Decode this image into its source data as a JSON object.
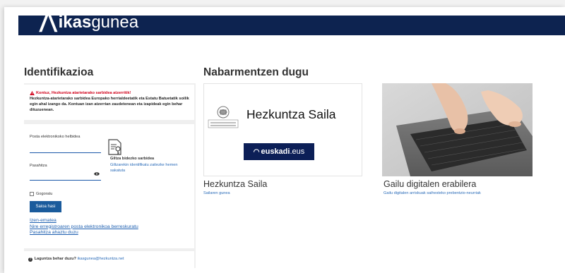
{
  "header": {
    "brand_bold": "ikas",
    "brand_rest": "gunea",
    "menu_icon": "hamburger-icon"
  },
  "login_panel": {
    "heading": "Identifikazioa",
    "warning": {
      "title": "Kontuz, Hezkuntza atarietarako sarbidea atzerritik!",
      "body": "Hezkuntza-atarietarako sarbidea Europako herrialdeetatik eta Estatu Batuetatik soilik egin ahal izango da. Kontuan izan atzerrian zaudetenean eta izapideak egin behar dituzuenean.",
      "icon": "warning-triangle-icon",
      "color": "#d0021b"
    },
    "email_label": "Posta elektronikoko helbidea",
    "email_value": "",
    "password_label": "Pasahitza",
    "password_value": "",
    "remember_label": "Gogoratu",
    "submit_label": "Saioa hasi",
    "key_access_title": "Giltza bidezko sarbidea",
    "key_access_sub": "Giltzarekin identifikatu zaitezke hemen sakatuta",
    "links": [
      "Izen-ematea",
      "Nire erregistroaren posta elektronikoa berreskuratu",
      "Pasahitza ahaztu duzu"
    ],
    "help_label": "Laguntza behar duzu?",
    "help_email": "ikasgunea@hezkuntza.net"
  },
  "featured": {
    "heading": "Nabarmentzen dugu",
    "cards": [
      {
        "logo_text": "Hezkuntza Saila",
        "badge_bold": "euskadi",
        "badge_rest": ".eus",
        "title": "Hezkuntza Saila",
        "subtitle": "Sailaren gunea"
      },
      {
        "title": "Gailu digitalen erabilera",
        "subtitle": "Gailu digitalen arriskuak saihesteko prebentzio-neurriak",
        "image": "laptop-typing-photo"
      }
    ]
  },
  "colors": {
    "header_bg": "#0d2350",
    "button_bg": "#1a5b9c",
    "link": "#1d5fb0"
  }
}
